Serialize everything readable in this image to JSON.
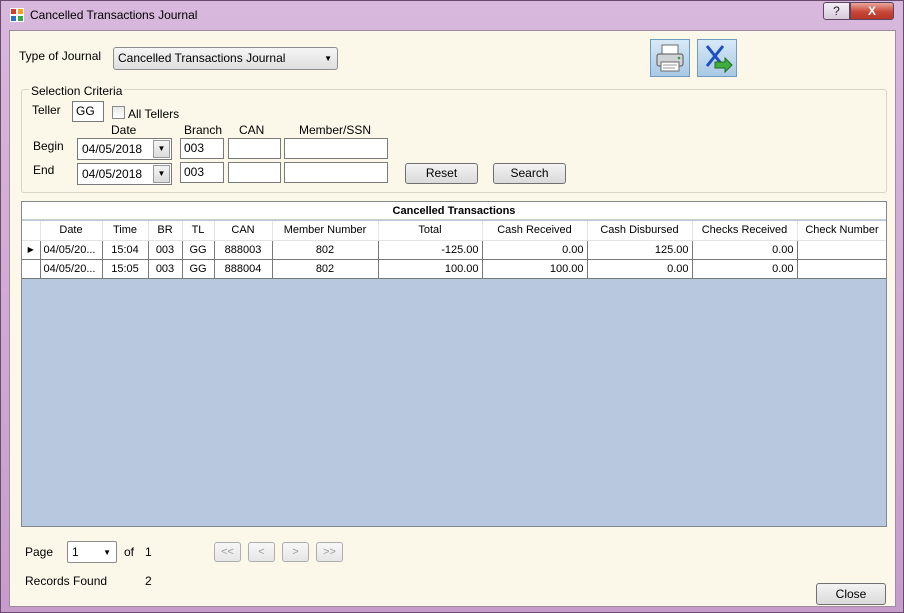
{
  "window": {
    "title": "Cancelled Transactions Journal",
    "help_glyph": "?",
    "close_glyph": "X"
  },
  "journal": {
    "type_label": "Type of Journal",
    "type_value": "Cancelled Transactions Journal"
  },
  "toolbar": {
    "print_icon": "printer-icon",
    "export_icon": "export-icon"
  },
  "criteria": {
    "group_title": "Selection Criteria",
    "teller_label": "Teller",
    "teller_value": "GG",
    "all_tellers_label": "All Tellers",
    "all_tellers_checked": false,
    "col_date": "Date",
    "col_branch": "Branch",
    "col_can": "CAN",
    "col_member": "Member/SSN",
    "begin_label": "Begin",
    "begin_date": "04/05/2018",
    "begin_branch": "003",
    "begin_can": "",
    "begin_member": "",
    "end_label": "End",
    "end_date": "04/05/2018",
    "end_branch": "003",
    "end_can": "",
    "end_member": "",
    "reset_label": "Reset",
    "search_label": "Search"
  },
  "grid": {
    "caption": "Cancelled Transactions",
    "columns": [
      "Date",
      "Time",
      "BR",
      "TL",
      "CAN",
      "Member Number",
      "Total",
      "Cash Received",
      "Cash Disbursed",
      "Checks Received",
      "Check Number"
    ],
    "rows": [
      [
        "04/05/20...",
        "15:04",
        "003",
        "GG",
        "888003",
        "802",
        "-125.00",
        "0.00",
        "125.00",
        "0.00",
        ""
      ],
      [
        "04/05/20...",
        "15:05",
        "003",
        "GG",
        "888004",
        "802",
        "100.00",
        "100.00",
        "0.00",
        "0.00",
        ""
      ]
    ],
    "current_row_glyph": "▶"
  },
  "paging": {
    "page_label": "Page",
    "page_value": "1",
    "of_label": "of",
    "total_pages": "1",
    "first": "<<",
    "prev": "<",
    "next": ">",
    "last": ">>"
  },
  "footer": {
    "records_label": "Records Found",
    "records_count": "2",
    "close_label": "Close"
  },
  "colors": {
    "client_bg": "#fbf8ea",
    "grid_empty_bg": "#b8c8de",
    "title_bar": "#c69ccb"
  }
}
